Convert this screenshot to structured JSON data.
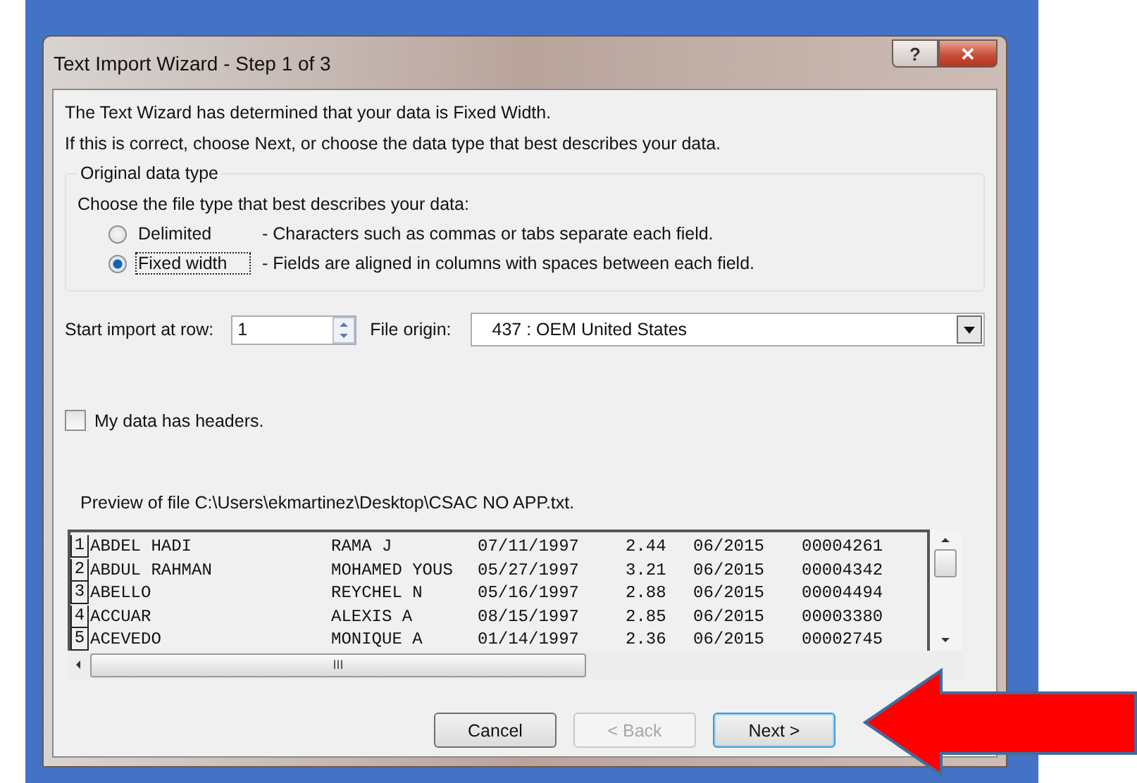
{
  "window": {
    "title": "Text Import Wizard - Step 1 of 3",
    "help_button": "?",
    "close_button": "✕"
  },
  "intro": [
    "The Text Wizard has determined that your data is Fixed Width.",
    "If this is correct, choose Next, or choose the data type that best describes your data."
  ],
  "data_type": {
    "legend": "Original data type",
    "prompt": "Choose the file type that best describes your data:",
    "options": [
      {
        "label": "Delimited",
        "description": "- Characters such as commas or tabs separate each field.",
        "selected": false
      },
      {
        "label": "Fixed width",
        "description": "- Fields are aligned in columns with spaces between each field.",
        "selected": true
      }
    ]
  },
  "start_row": {
    "label": "Start import at row:",
    "value": "1"
  },
  "file_origin": {
    "label": "File origin:",
    "value": "437 : OEM United States"
  },
  "headers_checkbox": {
    "label": "My data has headers.",
    "checked": false
  },
  "preview": {
    "label": "Preview of file C:\\Users\\ekmartinez\\Desktop\\CSAC NO APP.txt.",
    "scrollbar_grip": "III",
    "rows": [
      {
        "number": "1",
        "cells": [
          "ABDEL HADI",
          "RAMA J",
          "07/11/1997",
          "2.44",
          "06/2015",
          "00004261"
        ]
      },
      {
        "number": "2",
        "cells": [
          "ABDUL RAHMAN",
          "MOHAMED YOUS",
          "05/27/1997",
          "3.21",
          "06/2015",
          "00004342"
        ]
      },
      {
        "number": "3",
        "cells": [
          "ABELLO",
          "REYCHEL N",
          "05/16/1997",
          "2.88",
          "06/2015",
          "00004494"
        ]
      },
      {
        "number": "4",
        "cells": [
          "ACCUAR",
          "ALEXIS A",
          "08/15/1997",
          "2.85",
          "06/2015",
          "00003380"
        ]
      },
      {
        "number": "5",
        "cells": [
          "ACEVEDO",
          "MONIQUE A",
          "01/14/1997",
          "2.36",
          "06/2015",
          "00002745"
        ]
      }
    ]
  },
  "buttons": [
    {
      "label": "Cancel",
      "disabled": false,
      "default": false
    },
    {
      "label": "< Back",
      "disabled": true,
      "default": false
    },
    {
      "label": "Next >",
      "disabled": false,
      "default": true
    }
  ]
}
